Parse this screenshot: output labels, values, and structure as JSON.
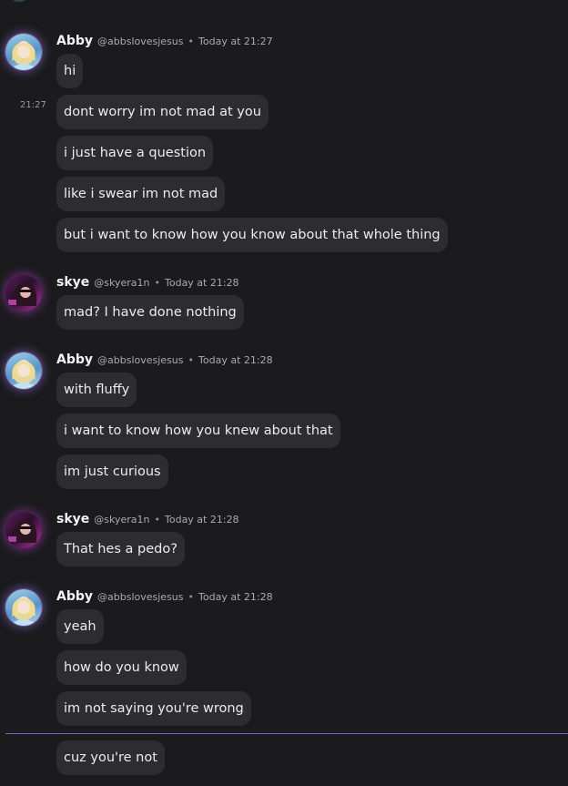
{
  "users": {
    "abby": {
      "name": "Abby",
      "handle": "@abbslovesjesus"
    },
    "skye": {
      "name": "skye",
      "handle": "@skyera1n"
    }
  },
  "separator": "•",
  "groups": [
    {
      "user": "Abby",
      "handle": "@abbslovesjesus",
      "time": "Today at 21:27",
      "side_time": "21:27",
      "messages": [
        "hi",
        "dont worry im not mad at you",
        "i just have a question",
        "like i swear im not mad",
        "but i want to know how you know about that whole thing"
      ]
    },
    {
      "user": "skye",
      "handle": "@skyera1n",
      "time": "Today at 21:28",
      "messages": [
        "mad? I have done nothing"
      ]
    },
    {
      "user": "Abby",
      "handle": "@abbslovesjesus",
      "time": "Today at 21:28",
      "messages": [
        "with fluffy",
        "i want to know how you knew about that",
        "im just curious"
      ]
    },
    {
      "user": "skye",
      "handle": "@skyera1n",
      "time": "Today at 21:28",
      "messages": [
        "That hes a pedo?"
      ]
    },
    {
      "user": "Abby",
      "handle": "@abbslovesjesus",
      "time": "Today at 21:28",
      "messages": [
        "yeah",
        "how do you know",
        "im not saying you're wrong",
        "cuz you're not"
      ]
    }
  ],
  "colors": {
    "background": "#1b1b1e",
    "bubble": "#2d2d31",
    "new_message_divider": "#7d63b8"
  }
}
